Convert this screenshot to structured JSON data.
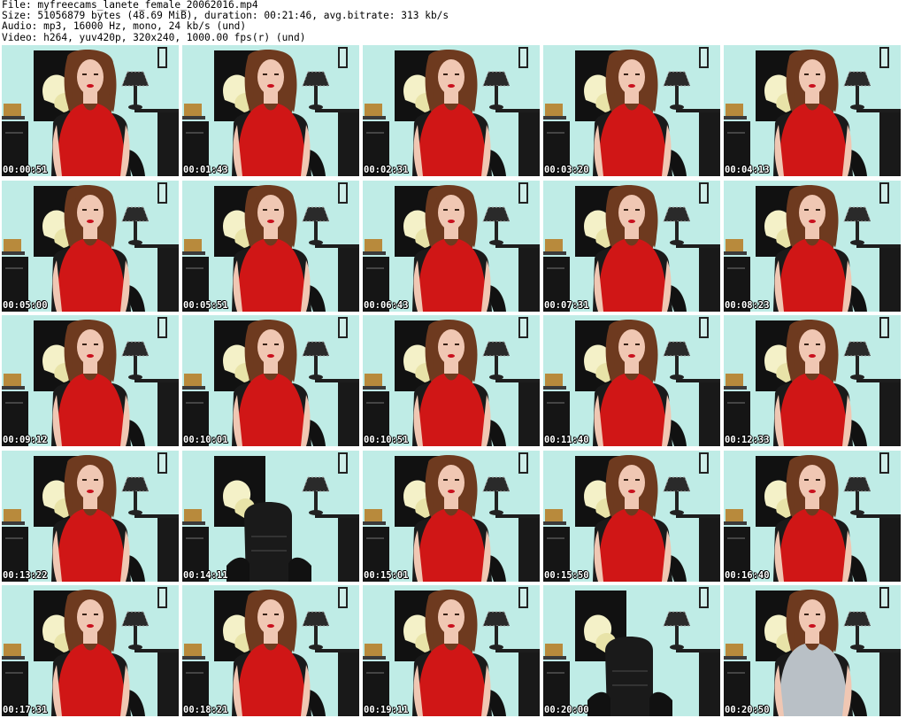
{
  "header": {
    "file": "File: myfreecams_lanete_female_20062016.mp4",
    "size": "Size: 51056879 bytes (48.69 MiB), duration: 00:21:46, avg.bitrate: 313 kb/s",
    "audio": "Audio: mp3, 16000 Hz, mono, 24 kb/s (und)",
    "video": "Video: h264, yuv420p, 320x240, 1000.00 fps(r) (und)"
  },
  "colors": {
    "wall": "#bfece6",
    "panel": "#111111",
    "shirt": "#d01616",
    "hair": "#6e3a1f",
    "skin": "#f0c7b3",
    "chair": "#1a1a1a",
    "gray_top": "#b9c0c6",
    "lily": "#f4f1c8"
  },
  "thumbs": [
    {
      "time": "00:00:51",
      "scene": "person",
      "top": "red"
    },
    {
      "time": "00:01:43",
      "scene": "person",
      "top": "red"
    },
    {
      "time": "00:02:31",
      "scene": "person",
      "top": "red"
    },
    {
      "time": "00:03:20",
      "scene": "person",
      "top": "red"
    },
    {
      "time": "00:04:13",
      "scene": "person",
      "top": "red"
    },
    {
      "time": "00:05:00",
      "scene": "person",
      "top": "red"
    },
    {
      "time": "00:05:51",
      "scene": "person",
      "top": "red"
    },
    {
      "time": "00:06:43",
      "scene": "person",
      "top": "red"
    },
    {
      "time": "00:07:31",
      "scene": "person",
      "top": "red"
    },
    {
      "time": "00:08:23",
      "scene": "person",
      "top": "red"
    },
    {
      "time": "00:09:12",
      "scene": "person",
      "top": "red"
    },
    {
      "time": "00:10:01",
      "scene": "person",
      "top": "red"
    },
    {
      "time": "00:10:51",
      "scene": "person",
      "top": "red"
    },
    {
      "time": "00:11:40",
      "scene": "person",
      "top": "red"
    },
    {
      "time": "00:12:33",
      "scene": "person",
      "top": "red"
    },
    {
      "time": "00:13:22",
      "scene": "person",
      "top": "red"
    },
    {
      "time": "00:14:11",
      "scene": "empty-chair",
      "top": "none"
    },
    {
      "time": "00:15:01",
      "scene": "person",
      "top": "red"
    },
    {
      "time": "00:15:50",
      "scene": "person",
      "top": "red"
    },
    {
      "time": "00:16:40",
      "scene": "person",
      "top": "red"
    },
    {
      "time": "00:17:31",
      "scene": "person",
      "top": "red"
    },
    {
      "time": "00:18:21",
      "scene": "person",
      "top": "red"
    },
    {
      "time": "00:19:11",
      "scene": "person",
      "top": "red"
    },
    {
      "time": "00:20:00",
      "scene": "empty-chair",
      "top": "none"
    },
    {
      "time": "00:20:50",
      "scene": "person",
      "top": "gray"
    }
  ]
}
